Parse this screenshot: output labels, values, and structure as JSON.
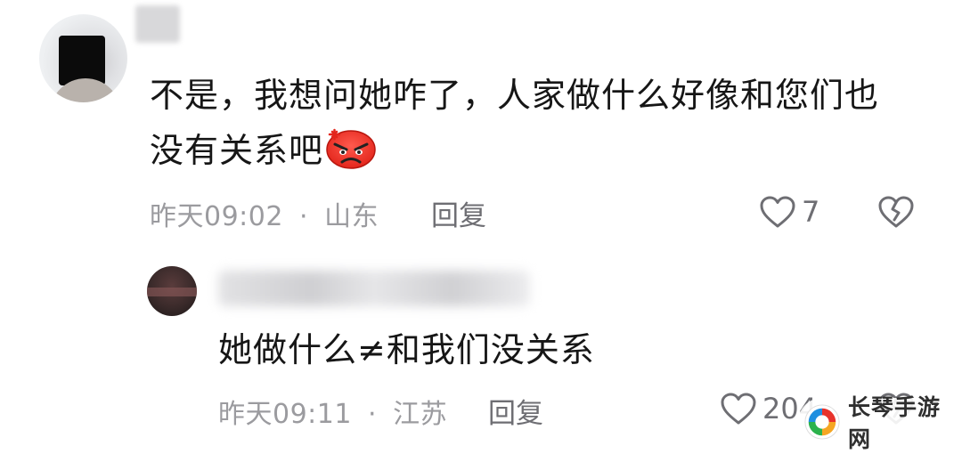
{
  "comments": [
    {
      "text_line1": "不是，我想问她咋了，人家做什么好像和您们也",
      "text_line2": "没有关系吧",
      "emoji": "angry-face-emoji",
      "time": "昨天09:02",
      "separator": "·",
      "location": "山东",
      "reply_label": "回复",
      "likes": "7"
    },
    {
      "text": "她做什么≠和我们没关系",
      "time": "昨天09:11",
      "separator": "·",
      "location": "江苏",
      "reply_label": "回复",
      "likes": "204"
    }
  ],
  "watermark": {
    "text": "长琴手游网"
  },
  "icons": {
    "like": "heart-outline-icon",
    "dislike": "broken-heart-icon"
  }
}
